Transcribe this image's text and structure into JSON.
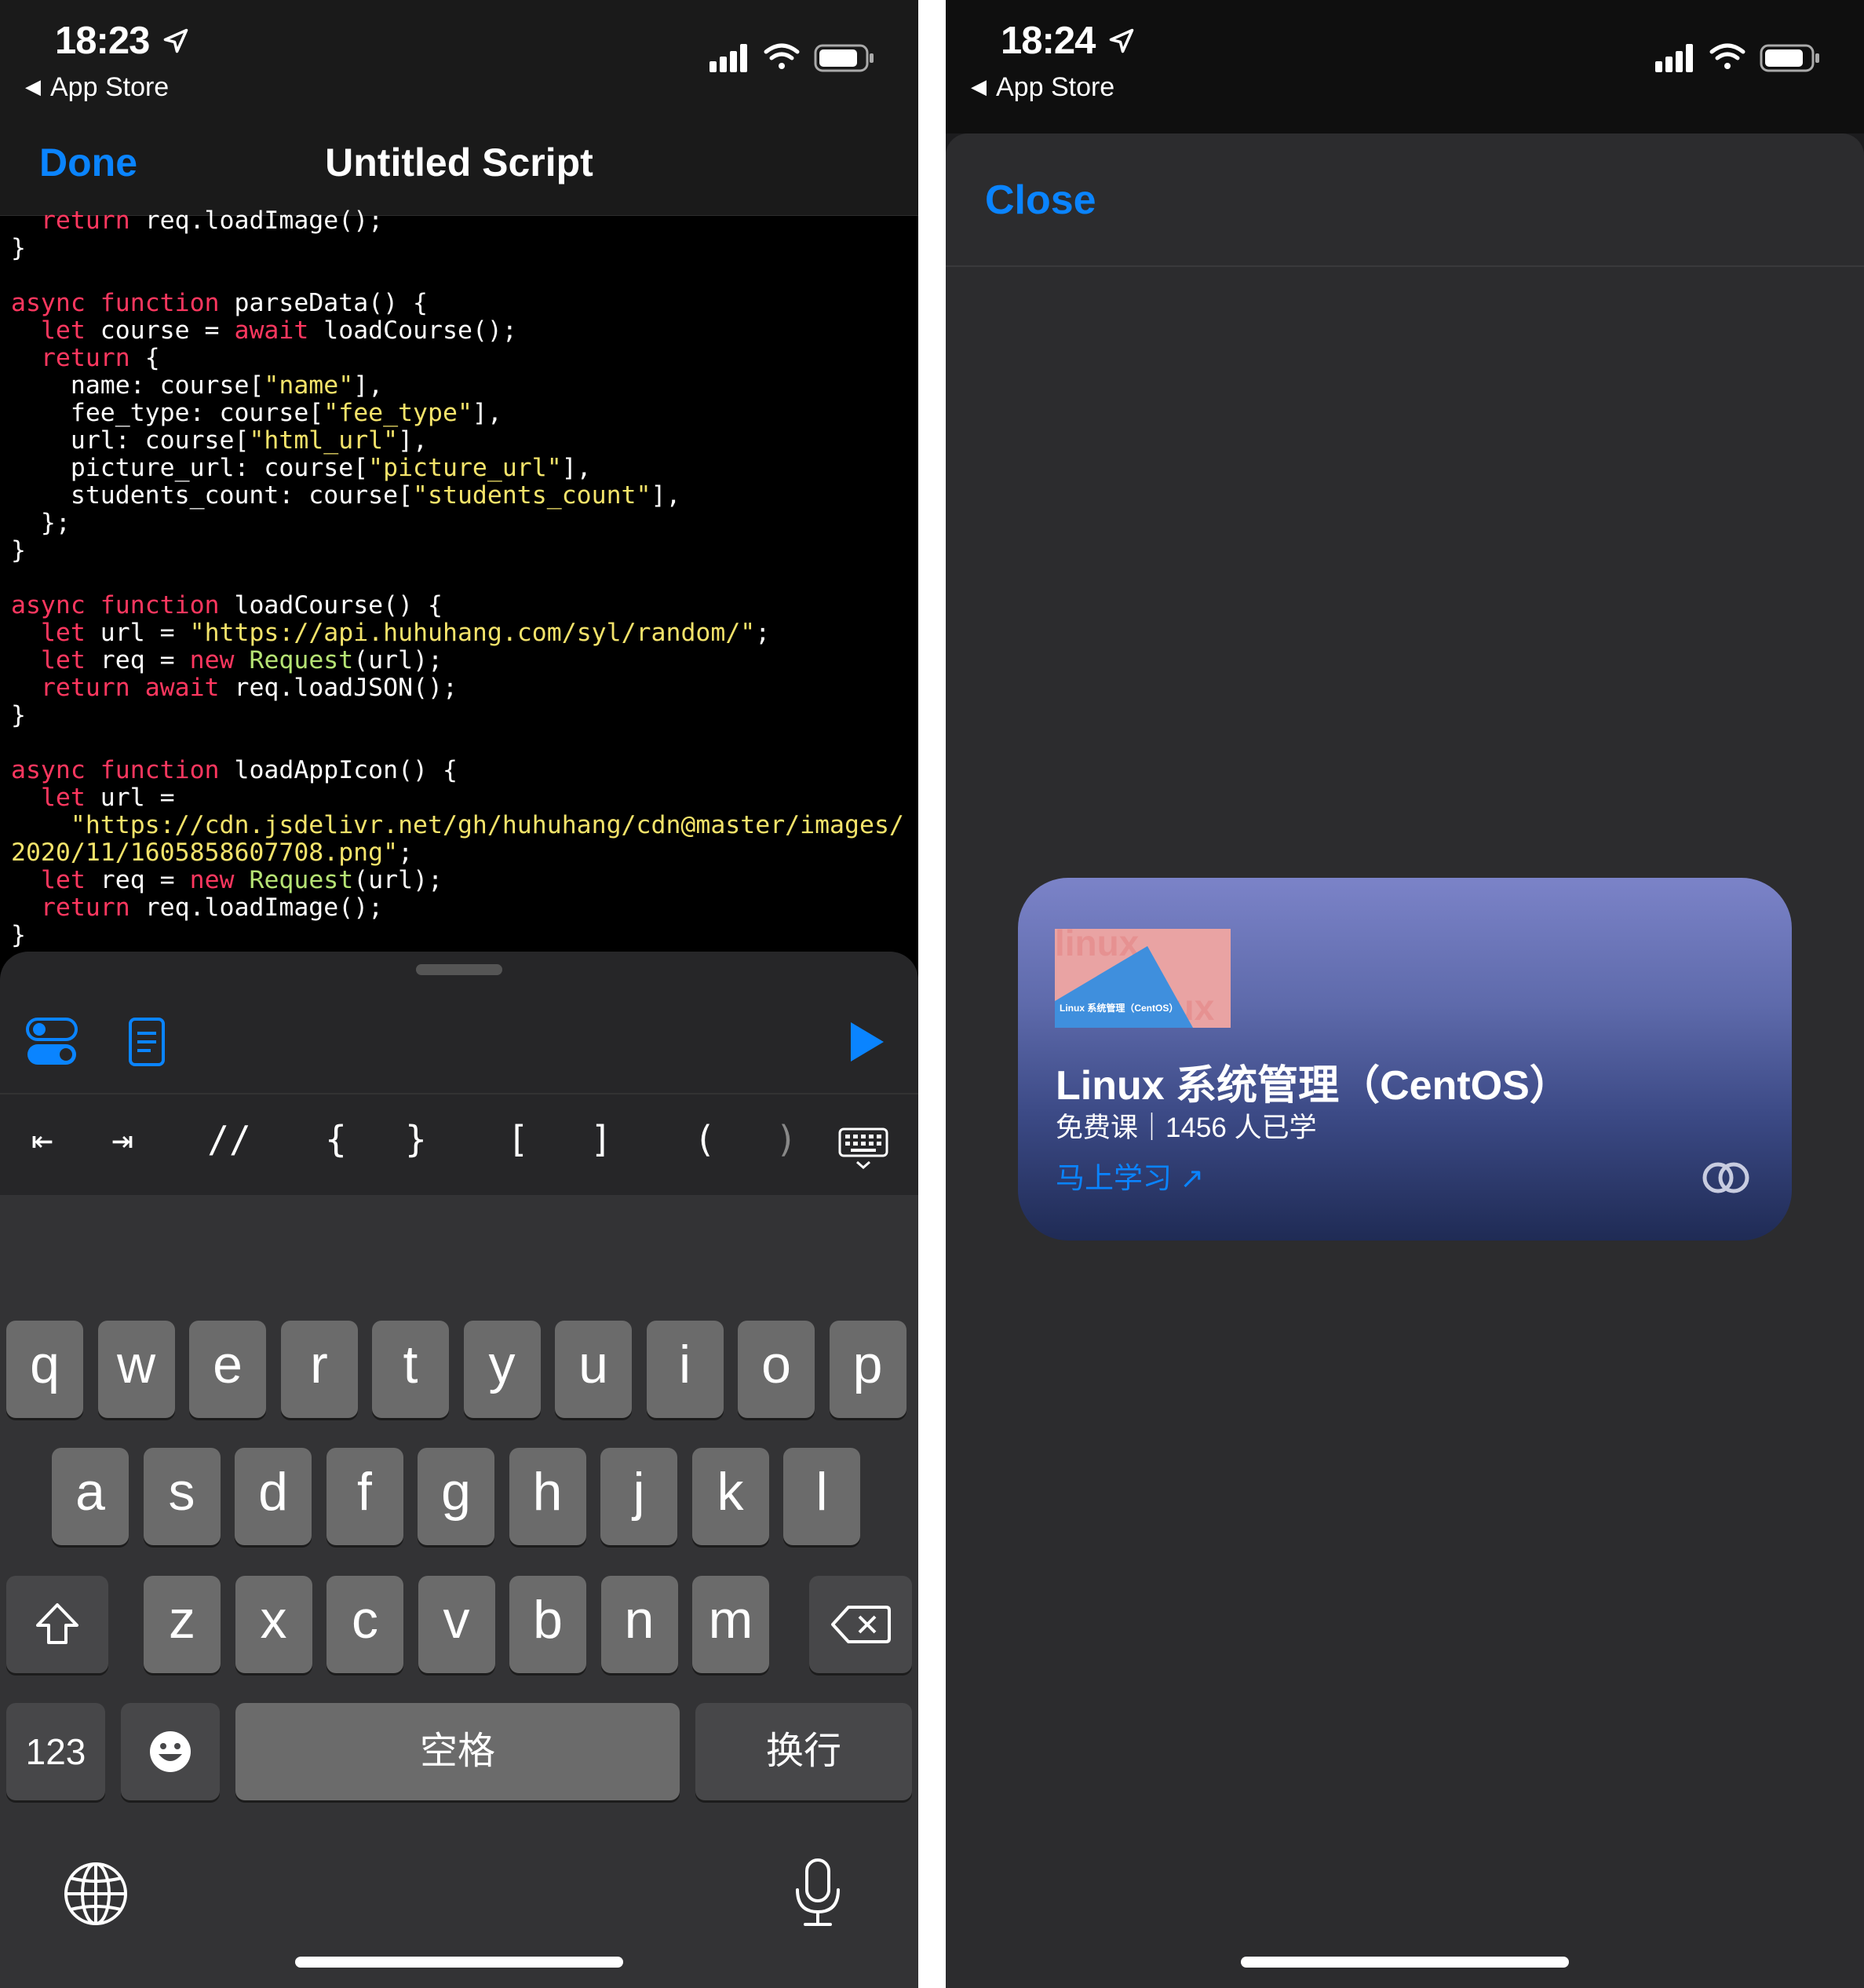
{
  "left_screen": {
    "status": {
      "time": "18:23",
      "back_label": "App Store"
    },
    "nav": {
      "done_label": "Done",
      "title": "Untitled Script"
    },
    "code_lines": [
      [
        [
          "  ",
          ""
        ],
        [
          "return",
          "kw"
        ],
        [
          " req.loadImage();",
          ""
        ]
      ],
      [
        [
          "}",
          ""
        ]
      ],
      [
        [
          "",
          ""
        ]
      ],
      [
        [
          "async",
          "kw"
        ],
        [
          " ",
          ""
        ],
        [
          "function",
          "kw"
        ],
        [
          " parseData() {",
          ""
        ]
      ],
      [
        [
          "  ",
          ""
        ],
        [
          "let",
          "kw"
        ],
        [
          " course = ",
          ""
        ],
        [
          "await",
          "kw"
        ],
        [
          " loadCourse();",
          ""
        ]
      ],
      [
        [
          "  ",
          ""
        ],
        [
          "return",
          "kw"
        ],
        [
          " {",
          ""
        ]
      ],
      [
        [
          "    name: course[",
          ""
        ],
        [
          "\"name\"",
          "str"
        ],
        [
          "],",
          ""
        ]
      ],
      [
        [
          "    fee_type: course[",
          ""
        ],
        [
          "\"fee_type\"",
          "str"
        ],
        [
          "],",
          ""
        ]
      ],
      [
        [
          "    url: course[",
          ""
        ],
        [
          "\"html_url\"",
          "str"
        ],
        [
          "],",
          ""
        ]
      ],
      [
        [
          "    picture_url: course[",
          ""
        ],
        [
          "\"picture_url\"",
          "str"
        ],
        [
          "],",
          ""
        ]
      ],
      [
        [
          "    students_count: course[",
          ""
        ],
        [
          "\"students_count\"",
          "str"
        ],
        [
          "],",
          ""
        ]
      ],
      [
        [
          "  };",
          ""
        ]
      ],
      [
        [
          "}",
          ""
        ]
      ],
      [
        [
          "",
          ""
        ]
      ],
      [
        [
          "async",
          "kw"
        ],
        [
          " ",
          ""
        ],
        [
          "function",
          "kw"
        ],
        [
          " loadCourse() {",
          ""
        ]
      ],
      [
        [
          "  ",
          ""
        ],
        [
          "let",
          "kw"
        ],
        [
          " url = ",
          ""
        ],
        [
          "\"https://api.huhuhang.com/syl/random/\"",
          "str"
        ],
        [
          ";",
          ""
        ]
      ],
      [
        [
          "  ",
          ""
        ],
        [
          "let",
          "kw"
        ],
        [
          " req = ",
          ""
        ],
        [
          "new",
          "kw"
        ],
        [
          " ",
          ""
        ],
        [
          "Request",
          "fn"
        ],
        [
          "(url);",
          ""
        ]
      ],
      [
        [
          "  ",
          ""
        ],
        [
          "return",
          "kw"
        ],
        [
          " ",
          ""
        ],
        [
          "await",
          "kw"
        ],
        [
          " req.loadJSON();",
          ""
        ]
      ],
      [
        [
          "}",
          ""
        ]
      ],
      [
        [
          "",
          ""
        ]
      ],
      [
        [
          "async",
          "kw"
        ],
        [
          " ",
          ""
        ],
        [
          "function",
          "kw"
        ],
        [
          " loadAppIcon() {",
          ""
        ]
      ],
      [
        [
          "  ",
          ""
        ],
        [
          "let",
          "kw"
        ],
        [
          " url =",
          ""
        ]
      ],
      [
        [
          "    ",
          ""
        ],
        [
          "\"https://cdn.jsdelivr.net/gh/huhuhang/cdn@master/images/",
          "str"
        ]
      ],
      [
        [
          "2020/11/1605858607708.png\"",
          "str"
        ],
        [
          ";",
          ""
        ]
      ],
      [
        [
          "  ",
          ""
        ],
        [
          "let",
          "kw"
        ],
        [
          " req = ",
          ""
        ],
        [
          "new",
          "kw"
        ],
        [
          " ",
          ""
        ],
        [
          "Request",
          "fn"
        ],
        [
          "(url);",
          ""
        ]
      ],
      [
        [
          "  ",
          ""
        ],
        [
          "return",
          "kw"
        ],
        [
          " req.loadImage();",
          ""
        ]
      ],
      [
        [
          "}",
          ""
        ]
      ]
    ],
    "toolbar": {
      "icons": [
        "settings-toggle-icon",
        "document-icon",
        "play-icon"
      ]
    },
    "symbols": [
      "⇤",
      "⇥",
      "//",
      "{",
      "}",
      "[",
      "]",
      "(",
      ")"
    ],
    "keyboard": {
      "row1": [
        "q",
        "w",
        "e",
        "r",
        "t",
        "y",
        "u",
        "i",
        "o",
        "p"
      ],
      "row2": [
        "a",
        "s",
        "d",
        "f",
        "g",
        "h",
        "j",
        "k",
        "l"
      ],
      "row3": [
        "z",
        "x",
        "c",
        "v",
        "b",
        "n",
        "m"
      ],
      "numbers_label": "123",
      "space_label": "空格",
      "return_label": "换行"
    }
  },
  "right_screen": {
    "status": {
      "time": "18:24",
      "back_label": "App Store"
    },
    "close_label": "Close",
    "widget": {
      "thumb_text": "Linux 系统管理（CentOS）",
      "title": "Linux 系统管理（CentOS）",
      "subtitle": "免费课｜1456 人已学",
      "link_label": "马上学习 ↗"
    }
  },
  "colors": {
    "accent": "#0a84ff",
    "keyword": "#ff375f",
    "string": "#f4e36a",
    "function": "#b5e374"
  }
}
